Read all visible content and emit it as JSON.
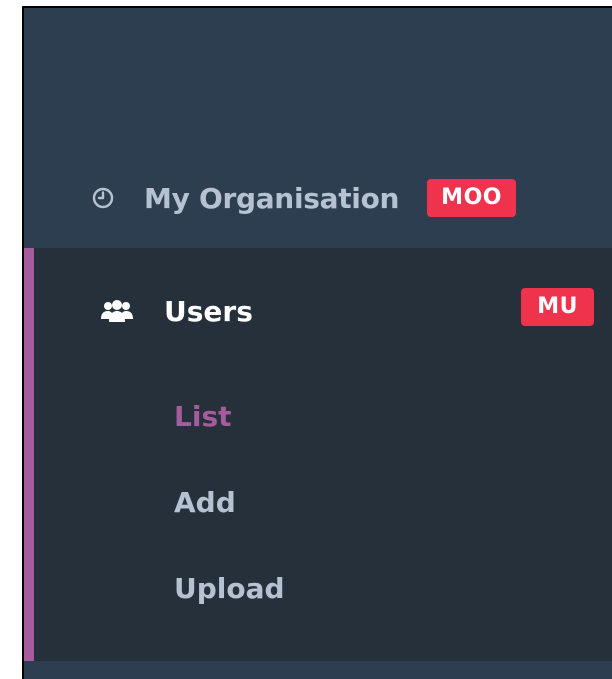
{
  "menu": {
    "org_item": {
      "label": "My Organisation",
      "badge": "MOO",
      "icon": "clock-icon"
    },
    "users_item": {
      "label": "Users",
      "badge": "MU",
      "icon": "users-icon"
    },
    "sub_items": [
      {
        "label": "List",
        "active": true
      },
      {
        "label": "Add",
        "active": false
      },
      {
        "label": "Upload",
        "active": false
      }
    ]
  },
  "colors": {
    "sidebar_bg": "#2c3e50",
    "section_bg": "#25303b",
    "accent": "#a45c9d",
    "badge_bg": "#f0334c",
    "text_muted": "#b6c2d1"
  }
}
